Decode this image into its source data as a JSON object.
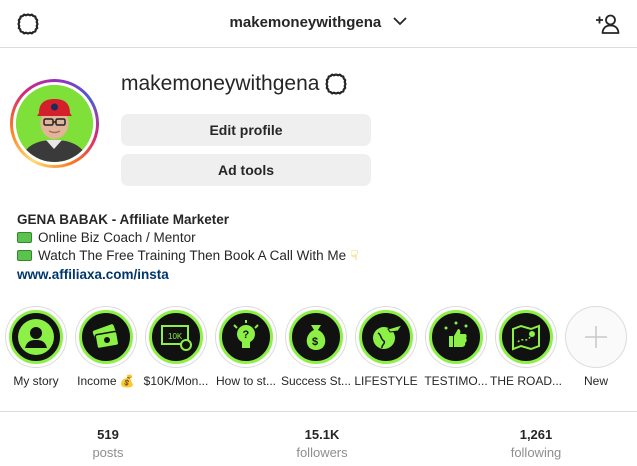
{
  "header": {
    "username": "makemoneywithgena"
  },
  "profile": {
    "name": "makemoneywithgena",
    "edit_button": "Edit profile",
    "ad_button": "Ad tools"
  },
  "bio": {
    "title": "GENA BABAK - Affiliate Marketer",
    "line1": "Online Biz Coach / Mentor",
    "line2": "Watch The Free Training Then Book A Call With Me",
    "link": "www.affiliaxa.com/insta"
  },
  "highlights": [
    {
      "label": "My story",
      "icon": "user-icon"
    },
    {
      "label": "Income 💰",
      "icon": "money-stack-icon"
    },
    {
      "label": "$10K/Mon...",
      "icon": "10k-bill-icon"
    },
    {
      "label": "How to st...",
      "icon": "lightbulb-icon"
    },
    {
      "label": "Success St...",
      "icon": "money-bag-icon"
    },
    {
      "label": "LIFESTYLE",
      "icon": "globe-plane-icon"
    },
    {
      "label": "TESTIMO...",
      "icon": "thumbs-up-icon"
    },
    {
      "label": "THE ROAD...",
      "icon": "map-icon"
    },
    {
      "label": "New",
      "icon": "plus-icon"
    }
  ],
  "stats": [
    {
      "value": "519",
      "label": "posts"
    },
    {
      "value": "15.1K",
      "label": "followers"
    },
    {
      "value": "1,261",
      "label": "following"
    }
  ],
  "colors": {
    "highlight_ring": "#8cf046",
    "link": "#00376b",
    "button_bg": "#efefef"
  }
}
